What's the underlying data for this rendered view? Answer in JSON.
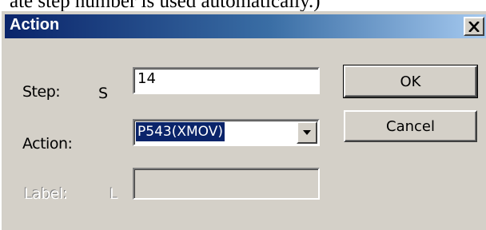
{
  "background_caption": "ate step number is used automatically.)",
  "dialog": {
    "title": "Action",
    "close_glyph": "×",
    "icons": [
      "close-icon",
      "dropdown-arrow-icon"
    ]
  },
  "form": {
    "step": {
      "label": "Step:",
      "prefix": "S",
      "value": "14"
    },
    "action": {
      "label": "Action:",
      "value": "P543(XMOV)"
    },
    "label_field": {
      "label": "Label:",
      "prefix": "L",
      "value": "",
      "enabled": false
    }
  },
  "buttons": {
    "ok": "OK",
    "cancel": "Cancel"
  },
  "colors": {
    "title_gradient_start": "#0a246a",
    "title_gradient_end": "#a6caf0",
    "dialog_face": "#d4d0c8",
    "selection": "#0a246a"
  }
}
